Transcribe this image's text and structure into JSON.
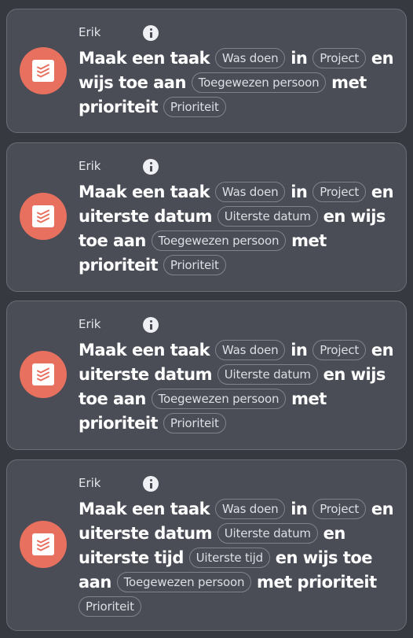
{
  "cards": [
    {
      "user": "Erik",
      "segments": [
        {
          "t": "Maak een taak "
        },
        {
          "chip": "Was doen"
        },
        {
          "t": " in "
        },
        {
          "chip": "Project"
        },
        {
          "t": " en wijs toe aan "
        },
        {
          "chip": "Toegewezen persoon"
        },
        {
          "t": " met prioriteit "
        },
        {
          "chip": "Prioriteit"
        }
      ]
    },
    {
      "user": "Erik",
      "segments": [
        {
          "t": "Maak een taak "
        },
        {
          "chip": "Was doen"
        },
        {
          "t": " in "
        },
        {
          "chip": "Project"
        },
        {
          "t": " en uiterste datum "
        },
        {
          "chip": "Uiterste datum"
        },
        {
          "t": " en wijs toe aan "
        },
        {
          "chip": "Toegewezen persoon"
        },
        {
          "t": " met prioriteit "
        },
        {
          "chip": "Prioriteit"
        }
      ]
    },
    {
      "user": "Erik",
      "segments": [
        {
          "t": "Maak een taak "
        },
        {
          "chip": "Was doen"
        },
        {
          "t": " in "
        },
        {
          "chip": "Project"
        },
        {
          "t": " en uiterste datum "
        },
        {
          "chip": "Uiterste datum"
        },
        {
          "t": " en wijs toe aan "
        },
        {
          "chip": "Toegewezen persoon"
        },
        {
          "t": " met prioriteit "
        },
        {
          "chip": "Prioriteit"
        }
      ]
    },
    {
      "user": "Erik",
      "segments": [
        {
          "t": "Maak een taak "
        },
        {
          "chip": "Was doen"
        },
        {
          "t": " in "
        },
        {
          "chip": "Project"
        },
        {
          "t": " en uiterste datum "
        },
        {
          "chip": "Uiterste datum"
        },
        {
          "t": " en uiterste tijd "
        },
        {
          "chip": "Uiterste tijd"
        },
        {
          "t": " en wijs toe aan "
        },
        {
          "chip": "Toegewezen persoon"
        },
        {
          "t": " met prioriteit "
        },
        {
          "chip": "Prioriteit"
        }
      ]
    }
  ],
  "icons": {
    "app": "todoist-icon",
    "info": "info-icon"
  },
  "colors": {
    "background": "#363940",
    "card": "#4a4d56",
    "card_border": "#6a6d76",
    "app_icon": "#e8705f",
    "chip_border": "#80838b"
  }
}
